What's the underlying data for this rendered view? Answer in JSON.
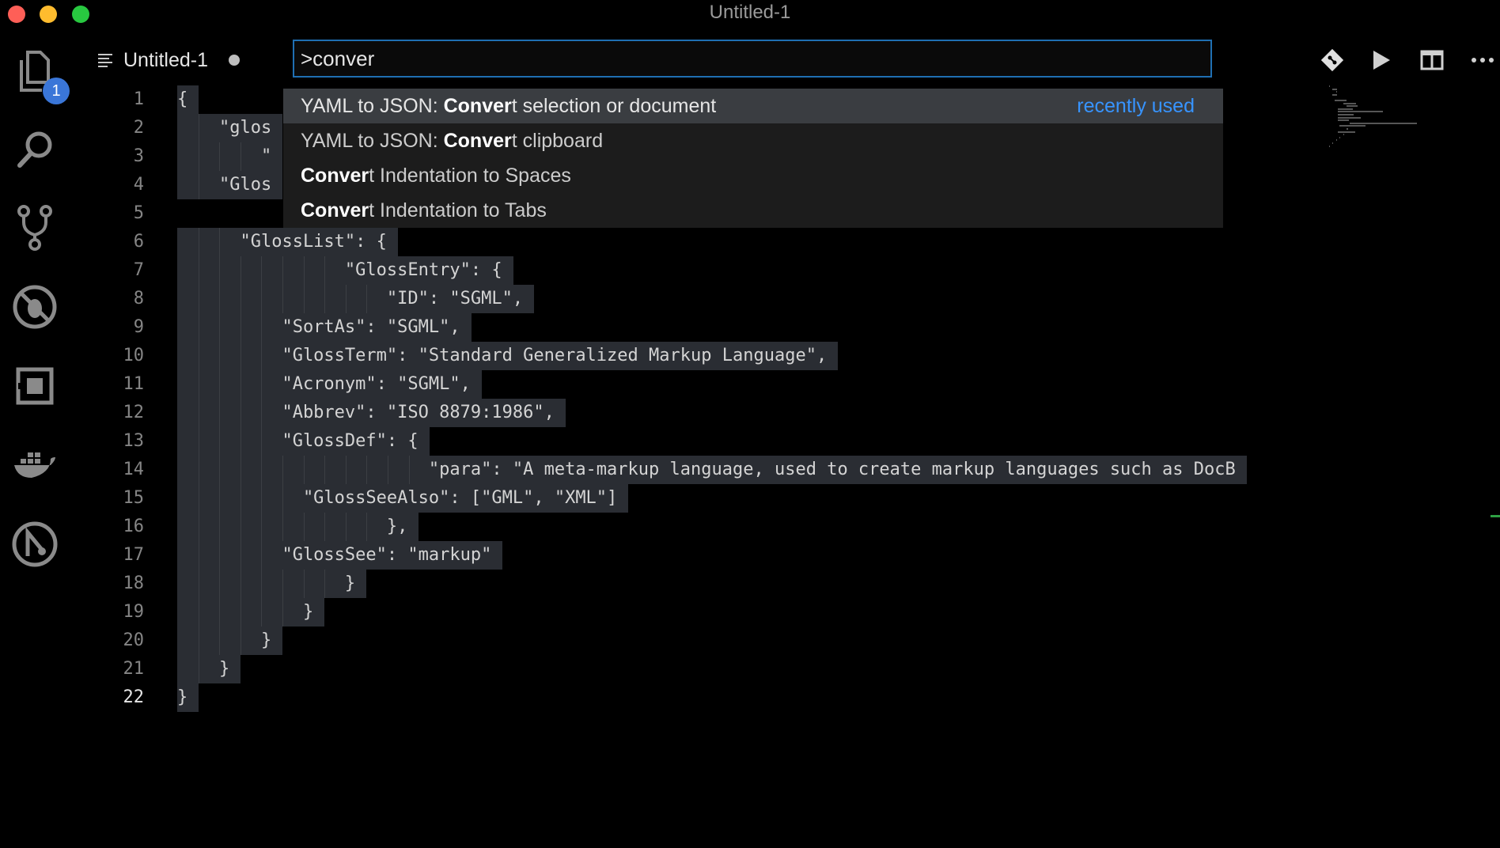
{
  "window": {
    "title": "Untitled-1"
  },
  "activity_bar": {
    "items": [
      {
        "name": "explorer",
        "icon": "files-icon",
        "badge": "1"
      },
      {
        "name": "search",
        "icon": "search-icon"
      },
      {
        "name": "source-control",
        "icon": "source-control-icon"
      },
      {
        "name": "debug",
        "icon": "debug-icon"
      },
      {
        "name": "extensions",
        "icon": "extensions-icon"
      },
      {
        "name": "docker",
        "icon": "docker-icon"
      },
      {
        "name": "remote",
        "icon": "remote-icon"
      }
    ]
  },
  "editor": {
    "tab": {
      "label": "Untitled-1",
      "dirty": true
    },
    "line_numbers": [
      "1",
      "2",
      "3",
      "4",
      "5",
      "6",
      "7",
      "8",
      "9",
      "10",
      "11",
      "12",
      "13",
      "14",
      "15",
      "16",
      "17",
      "18",
      "19",
      "20",
      "21",
      "22"
    ],
    "active_line": "22",
    "lines": [
      "{",
      "    \"glos",
      "        \"",
      "    \"Glos",
      "",
      "      \"GlossList\": {",
      "                \"GlossEntry\": {",
      "                    \"ID\": \"SGML\",",
      "          \"SortAs\": \"SGML\",",
      "          \"GlossTerm\": \"Standard Generalized Markup Language\",",
      "          \"Acronym\": \"SGML\",",
      "          \"Abbrev\": \"ISO 8879:1986\",",
      "          \"GlossDef\": {",
      "                        \"para\": \"A meta-markup language, used to create markup languages such as DocB",
      "            \"GlossSeeAlso\": [\"GML\", \"XML\"]",
      "                    },",
      "          \"GlossSee\": \"markup\"",
      "                }",
      "            }",
      "        }",
      "    }",
      "}"
    ]
  },
  "toolbar": {
    "icons": [
      "git-icon",
      "run-icon",
      "split-editor-icon",
      "more-icon"
    ]
  },
  "command_palette": {
    "input_value": ">conver",
    "items": [
      {
        "prefix": "YAML to JSON: ",
        "match": "Conver",
        "suffix": "t selection or document",
        "tag": "recently used"
      },
      {
        "prefix": "YAML to JSON: ",
        "match": "Conver",
        "suffix": "t clipboard",
        "tag": ""
      },
      {
        "prefix": "",
        "match": "Conver",
        "suffix": "t Indentation to Spaces",
        "tag": ""
      },
      {
        "prefix": "",
        "match": "Conver",
        "suffix": "t Indentation to Tabs",
        "tag": ""
      }
    ]
  },
  "colors": {
    "accent": "#3794ff",
    "focus_border": "#1f6fb2",
    "badge": "#3a76d8",
    "selection": "#2a2d33"
  }
}
